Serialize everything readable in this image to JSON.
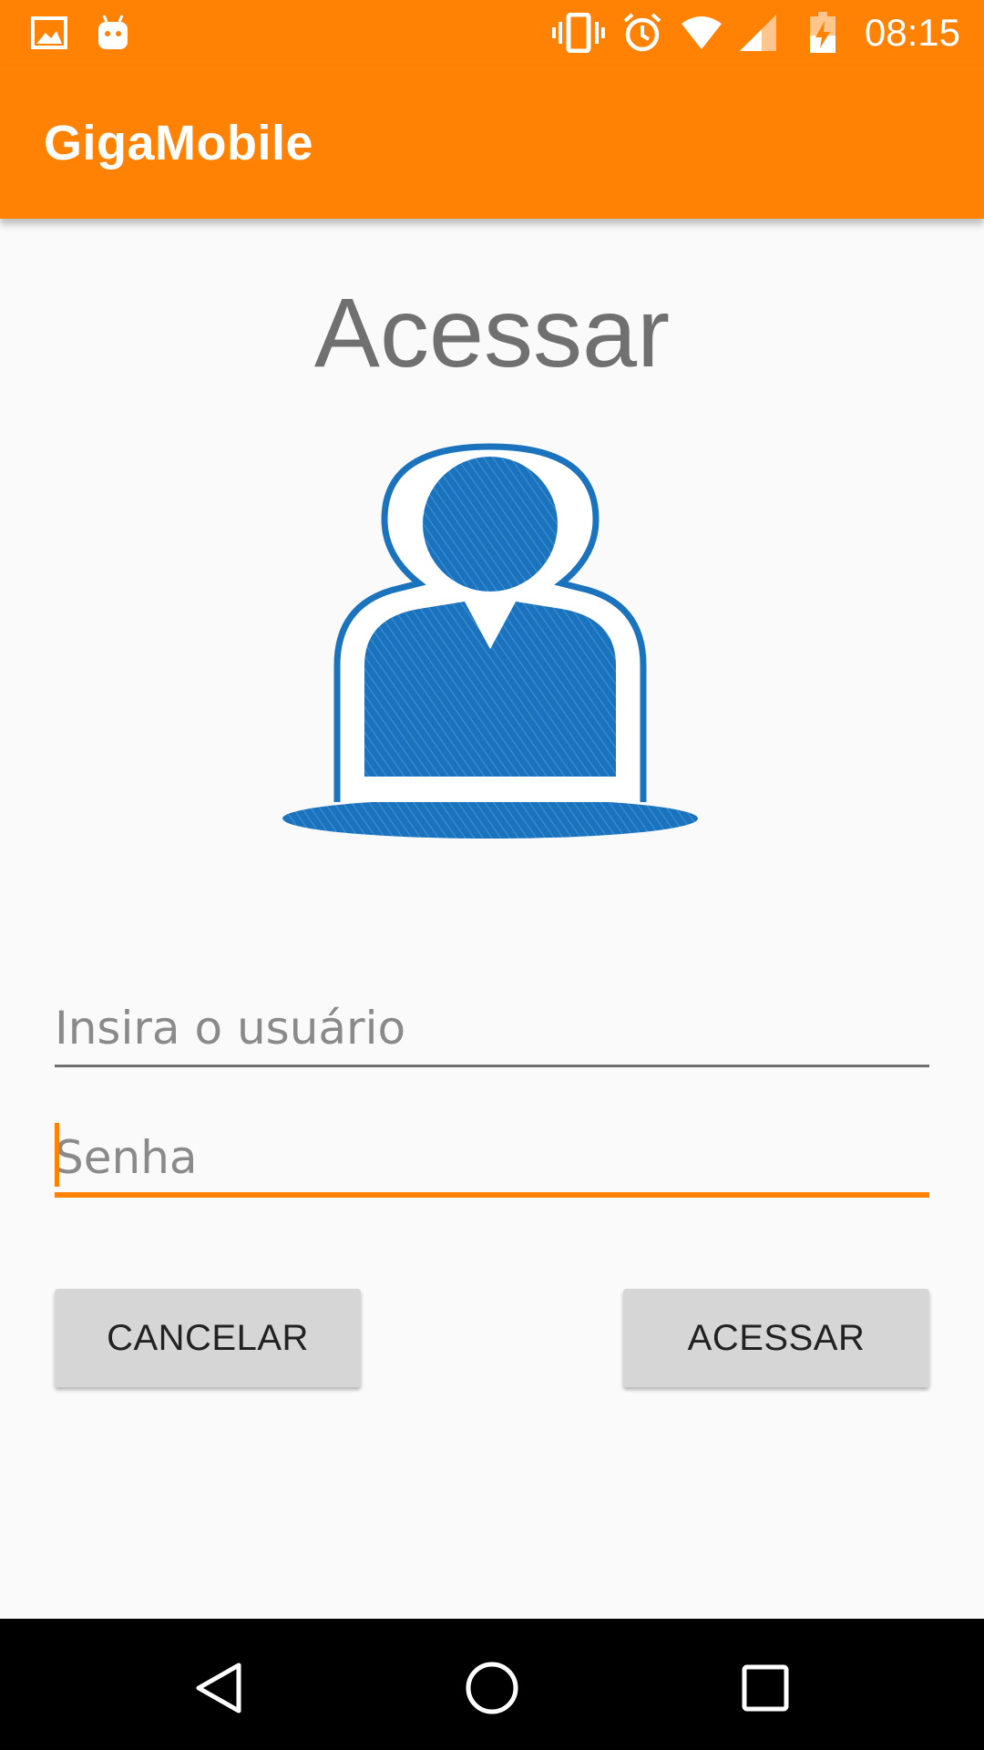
{
  "status_bar": {
    "time": "08:15",
    "icons": [
      "image-icon",
      "android-icon",
      "vibrate-icon",
      "alarm-icon",
      "wifi-icon",
      "cell-signal-icon",
      "battery-charging-icon"
    ],
    "background": "#ff8204"
  },
  "toolbar": {
    "app_title": "GigaMobile",
    "background": "#ff8204"
  },
  "login": {
    "title": "Acessar",
    "avatar_icon": "user-avatar-icon",
    "username": {
      "value": "",
      "placeholder": "Insira o usuário"
    },
    "password": {
      "value": "",
      "placeholder": "Senha",
      "focused": true
    },
    "cancel_label": "CANCELAR",
    "access_label": "ACESSAR"
  },
  "colors": {
    "accent": "#ff8204",
    "avatar_blue": "#1b73be",
    "button_gray": "#d6d6d6"
  },
  "nav_bar": {
    "icons": [
      "back-icon",
      "home-icon",
      "recents-icon"
    ]
  }
}
